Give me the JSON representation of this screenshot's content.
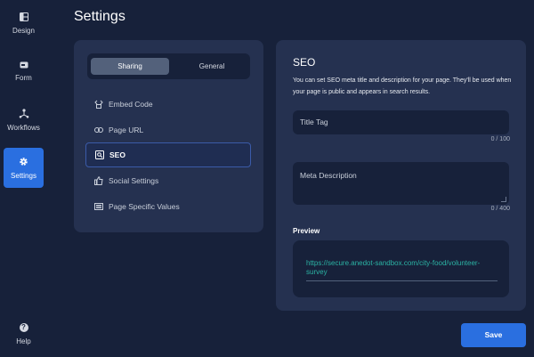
{
  "page_title": "Settings",
  "nav": {
    "design": "Design",
    "form": "Form",
    "workflows": "Workflows",
    "settings": "Settings",
    "help": "Help"
  },
  "tabs": {
    "sharing": "Sharing",
    "general": "General"
  },
  "menu": {
    "items": [
      {
        "label": "Embed Code",
        "icon": "embed-code-icon"
      },
      {
        "label": "Page URL",
        "icon": "link-icon"
      },
      {
        "label": "SEO",
        "icon": "seo-icon"
      },
      {
        "label": "Social Settings",
        "icon": "thumbs-up-icon"
      },
      {
        "label": "Page Specific Values",
        "icon": "list-icon"
      }
    ],
    "active_index": 2
  },
  "seo": {
    "title": "SEO",
    "description": "You can set SEO meta title and description for your page. They'll be used when your page is public and appears in search results.",
    "title_tag": {
      "placeholder": "Title Tag",
      "counter": "0 / 100"
    },
    "meta_description": {
      "placeholder": "Meta Description",
      "counter": "0 / 400"
    },
    "preview_label": "Preview",
    "preview_url": "https://secure.anedot-sandbox.com/city-food/volunteer-survey"
  },
  "save_label": "Save",
  "colors": {
    "background": "#17213a",
    "panel": "#253150",
    "accent": "#2a6fe0",
    "link": "#2bb3a4"
  }
}
